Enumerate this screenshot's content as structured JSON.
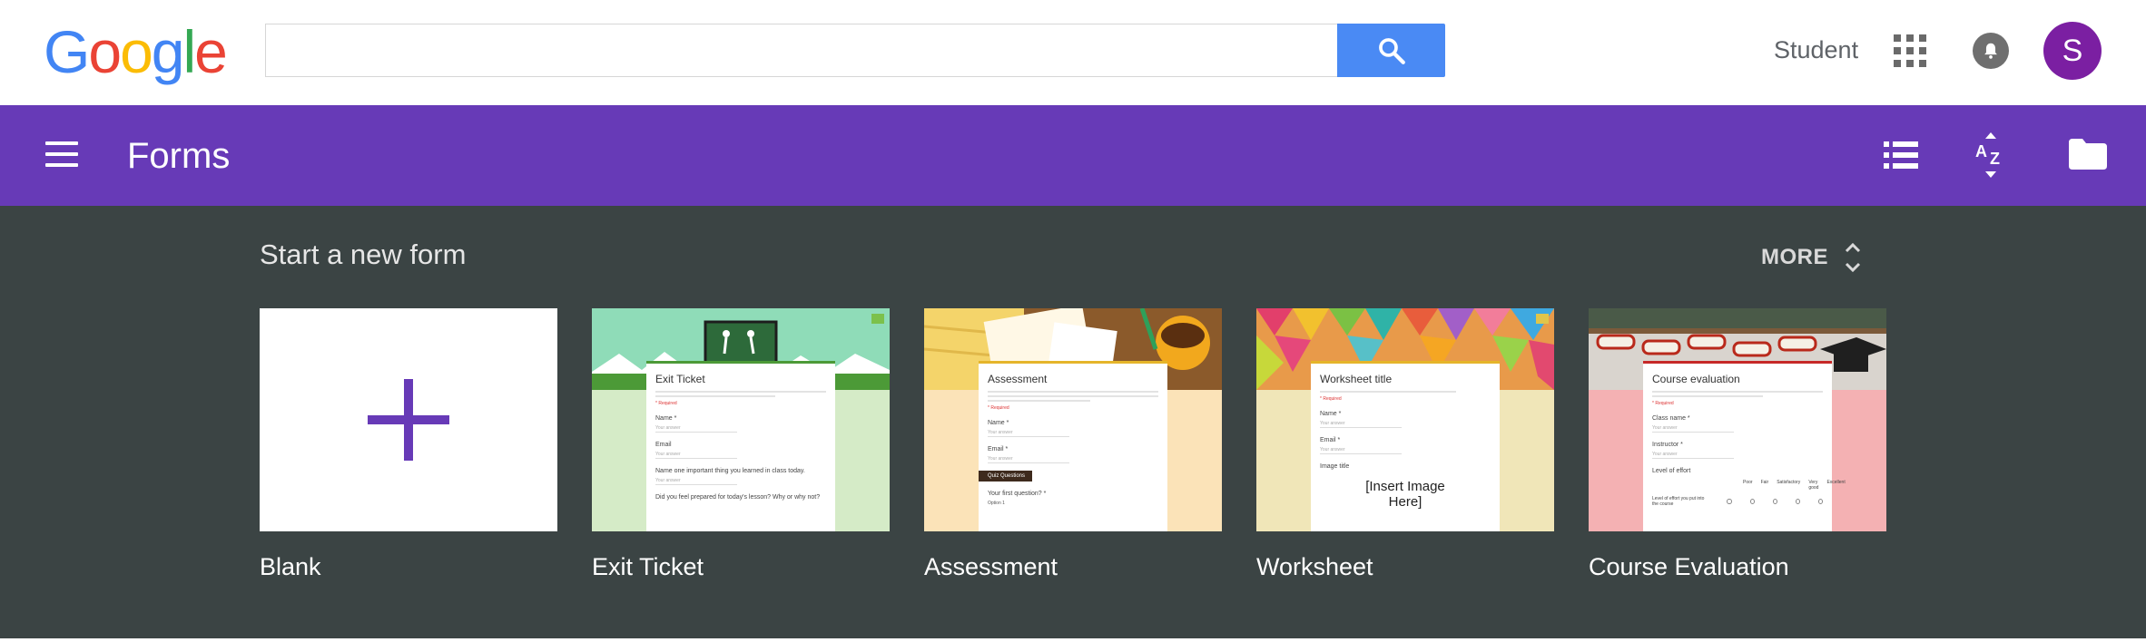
{
  "google": {
    "logo_letters": [
      {
        "ch": "G",
        "color": "#4285F4"
      },
      {
        "ch": "o",
        "color": "#EA4335"
      },
      {
        "ch": "o",
        "color": "#FBBC05"
      },
      {
        "ch": "g",
        "color": "#4285F4"
      },
      {
        "ch": "l",
        "color": "#34A853"
      },
      {
        "ch": "e",
        "color": "#EA4335"
      }
    ],
    "search_value": "",
    "user_label": "Student",
    "avatar_letter": "S",
    "avatar_color": "#7B1FA2"
  },
  "appbar": {
    "title": "Forms",
    "color": "#673AB7"
  },
  "gallery": {
    "title": "Start a new form",
    "more_label": "MORE",
    "background": "#3B4444",
    "templates": [
      {
        "label": "Blank"
      },
      {
        "label": "Exit Ticket",
        "preview": {
          "title": "Exit Ticket",
          "required": "* Required",
          "fields": [
            "Name *",
            "Email",
            "Name one important thing you learned in class today.",
            "Did you feel prepared for today's lesson? Why or why not?"
          ],
          "placeholder": "Your answer"
        }
      },
      {
        "label": "Assessment",
        "preview": {
          "title": "Assessment",
          "required": "* Required",
          "fields": [
            "Name *",
            "Email *"
          ],
          "section": "Quiz Questions",
          "question": "Your first question? *",
          "option": "Option 1",
          "placeholder": "Your answer"
        }
      },
      {
        "label": "Worksheet",
        "preview": {
          "title": "Worksheet title",
          "required": "* Required",
          "fields": [
            "Name *",
            "Email *",
            "Image title"
          ],
          "image_text": "[Insert Image Here]",
          "placeholder": "Your answer"
        }
      },
      {
        "label": "Course Evaluation",
        "preview": {
          "title": "Course evaluation",
          "required": "* Required",
          "fields": [
            "Class name *",
            "Instructor *",
            "Level of effort"
          ],
          "scale": [
            "Poor",
            "Fair",
            "Satisfactory",
            "Very good",
            "Excellent"
          ],
          "row_label": "Level of effort you put into the course",
          "placeholder": "Your answer"
        }
      }
    ]
  },
  "icons": {
    "search": "search-icon",
    "apps": "apps-grid-icon",
    "notifications": "bell-icon",
    "menu": "hamburger-menu-icon",
    "list_view": "list-view-icon",
    "sort": "sort-az-icon",
    "folder": "folder-icon",
    "expand": "unfold-icon",
    "add": "plus-icon"
  }
}
